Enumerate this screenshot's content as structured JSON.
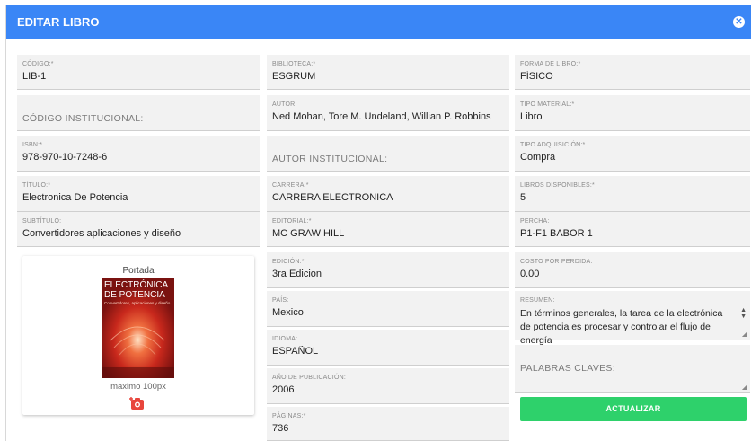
{
  "header": {
    "title": "EDITAR LIBRO",
    "close_icon": "close-icon"
  },
  "col1": {
    "codigo": {
      "label": "CÓDIGO:*",
      "value": "LIB-1"
    },
    "codigo_inst": {
      "placeholder": "CÓDIGO INSTITUCIONAL:"
    },
    "isbn": {
      "label": "ISBN:*",
      "value": "978-970-10-7248-6"
    },
    "titulo": {
      "label": "TÍTULO:*",
      "value": "Electronica De Potencia"
    },
    "subtitulo": {
      "label": "SUBTÍTULO:",
      "value": "Convertidores aplicaciones y diseño"
    }
  },
  "cover": {
    "title": "Portada",
    "note": "maximo 100px",
    "book_title_1": "ELECTRÓNICA",
    "book_title_2": "DE POTENCIA",
    "book_sub": "Convertidores, aplicaciones y diseño"
  },
  "col2": {
    "biblioteca": {
      "label": "BIBLIOTECA:*",
      "value": "ESGRUM"
    },
    "autor": {
      "label": "AUTOR:",
      "value": "Ned Mohan, Tore M. Undeland, Willian P. Robbins"
    },
    "autor_inst": {
      "placeholder": "AUTOR INSTITUCIONAL:"
    },
    "carrera": {
      "label": "CARRERA:*",
      "value": "CARRERA ELECTRONICA"
    },
    "editorial": {
      "label": "EDITORIAL:*",
      "value": "MC GRAW HILL"
    },
    "edicion": {
      "label": "EDICIÓN:*",
      "value": "3ra Edicion"
    },
    "pais": {
      "label": "PAÍS:",
      "value": "Mexico"
    },
    "idioma": {
      "label": "IDIOMA:",
      "value": "ESPAÑOL"
    },
    "anio": {
      "label": "AÑO DE PUBLICACIÓN:",
      "value": "2006"
    },
    "paginas": {
      "label": "PÁGINAS:*",
      "value": "736"
    }
  },
  "col3": {
    "forma": {
      "label": "FORMA DE LIBRO:*",
      "value": "FÍSICO"
    },
    "tipo_material": {
      "label": "TIPO MATERIAL:*",
      "value": "Libro"
    },
    "tipo_adq": {
      "label": "TIPO ADQUISICIÓN:*",
      "value": "Compra"
    },
    "disponibles": {
      "label": "LIBROS DISPONIBLES:*",
      "value": "5"
    },
    "percha": {
      "label": "PERCHA:",
      "value": "P1-F1 BABOR 1"
    },
    "costo": {
      "label": "COSTO POR PERDIDA:",
      "value": "0.00"
    },
    "resumen": {
      "label": "RESUMEN:",
      "value": "En términos generales, la tarea de la electrónica de potencia es procesar y controlar el flujo de energía"
    },
    "palabras": {
      "placeholder": "PALABRAS CLAVES:"
    }
  },
  "actions": {
    "submit_label": "ACTUALIZAR"
  },
  "colors": {
    "header": "#3a86f6",
    "submit": "#2ed16b",
    "field_bg": "#f2f2f2"
  }
}
